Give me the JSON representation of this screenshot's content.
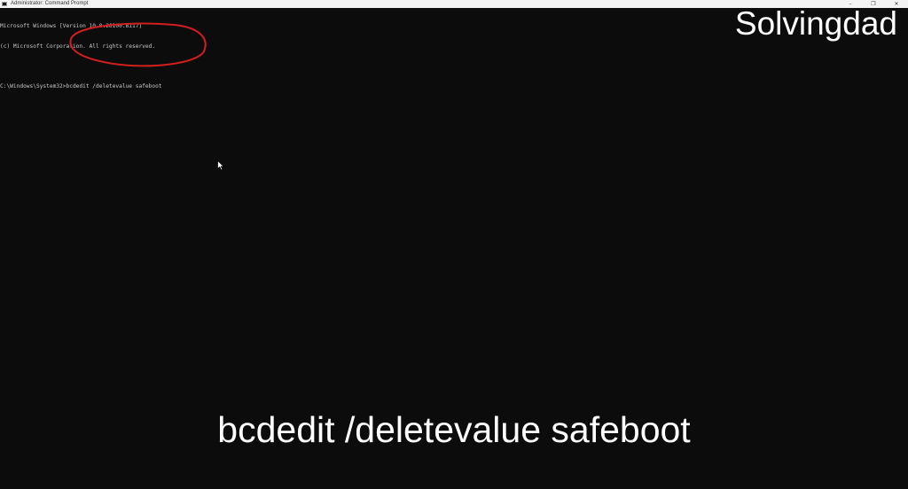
{
  "window": {
    "title": "Administrator: Command Prompt",
    "controls": {
      "minimize": "–",
      "maximize": "❐",
      "close": "✕"
    }
  },
  "console": {
    "lines": [
      "Microsoft Windows [Version 10.0.26100.8117]",
      "(c) Microsoft Corporation. All rights reserved.",
      "",
      "C:\\Windows\\System32>bcdedit /deletevalue safeboot"
    ],
    "text_color": "#c8c8c8",
    "background": "#0c0c0c"
  },
  "overlay": {
    "watermark": "Solvingdad",
    "caption": "bcdedit /deletevalue safeboot",
    "highlight_color": "#d11f1f"
  }
}
